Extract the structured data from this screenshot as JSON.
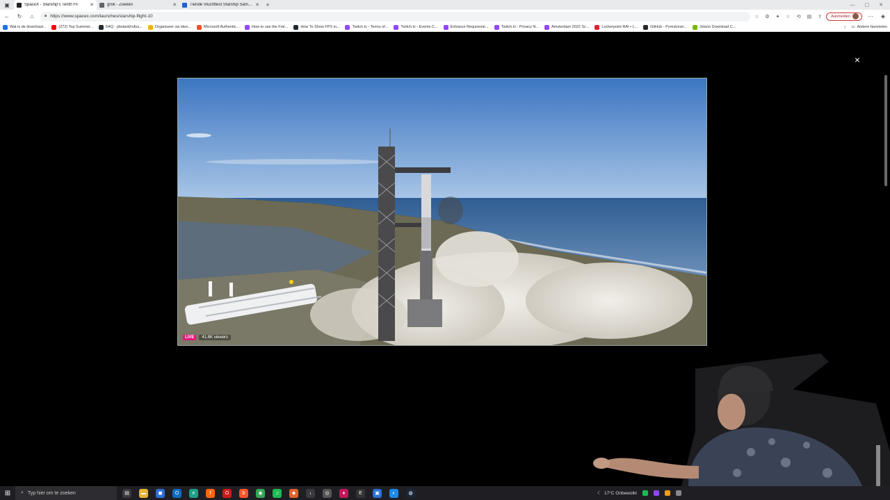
{
  "browser": {
    "tabs": [
      {
        "title": "SpaceX - Starship's Tenth Fli",
        "active": true,
        "favicon_color": "#222222"
      },
      {
        "title": "grok - Zoeken",
        "active": false,
        "favicon_color": "#5f6368"
      },
      {
        "title": "Tiende Vluchttest Starship Samen",
        "active": false,
        "favicon_color": "#1f5fd6"
      }
    ],
    "new_tab_glyph": "+",
    "url": "https://www.spacex.com/launches/starship-flight-10",
    "signin_label": "Aanmelden",
    "favorites": [
      {
        "label": "Wat is de download...",
        "color": "#1a73e8"
      },
      {
        "label": "(272) Top Summer...",
        "color": "#ff0000"
      },
      {
        "label": "FAQ · pbstard/rufus...",
        "color": "#24292f"
      },
      {
        "label": "Organiseer uw idee...",
        "color": "#f4b400"
      },
      {
        "label": "Microsoft Authentic...",
        "color": "#f25022"
      },
      {
        "label": "How to use the Frie...",
        "color": "#9146ff"
      },
      {
        "label": "How To Show FPS in...",
        "color": "#24292f"
      },
      {
        "label": "Twitch.tv - Terms of...",
        "color": "#9146ff"
      },
      {
        "label": "Twitch.tv - Events C...",
        "color": "#9146ff"
      },
      {
        "label": "Entrance Requireme...",
        "color": "#9146ff"
      },
      {
        "label": "Twitch.tv - Privacy N...",
        "color": "#9146ff"
      },
      {
        "label": "Amsterdam 2022 Sc...",
        "color": "#9146ff"
      },
      {
        "label": "Lockerpoint RAI • L...",
        "color": "#d23"
      },
      {
        "label": "GitHub - Pyrestone/...",
        "color": "#24292f"
      },
      {
        "label": "Jetson Download C...",
        "color": "#76b900"
      }
    ],
    "other_favorites": "Andere favorieten"
  },
  "page": {
    "close_glyph": "×",
    "video": {
      "live_label": "LIVE",
      "viewers": "41.8K viewers"
    }
  },
  "taskbar": {
    "search_placeholder": "Typ hier om te zoeken",
    "weather": "17°C  Onbewolkt",
    "apps": [
      {
        "name": "task-view",
        "color": "#3a3a3e",
        "glyph": "▤"
      },
      {
        "name": "file-explorer",
        "color": "#e8b23a",
        "glyph": "▬"
      },
      {
        "name": "store",
        "color": "#2b6fd6",
        "glyph": "◼"
      },
      {
        "name": "outlook",
        "color": "#0f6cbd",
        "glyph": "O"
      },
      {
        "name": "edge",
        "color": "#1f9e88",
        "glyph": "e"
      },
      {
        "name": "firefox",
        "color": "#ff6611",
        "glyph": "f"
      },
      {
        "name": "opera",
        "color": "#cc1a1a",
        "glyph": "O"
      },
      {
        "name": "brave",
        "color": "#fb542b",
        "glyph": "b"
      },
      {
        "name": "chrome",
        "color": "#34a853",
        "glyph": "◉"
      },
      {
        "name": "spotify",
        "color": "#1db954",
        "glyph": "♫"
      },
      {
        "name": "app-orange",
        "color": "#e2622e",
        "glyph": "◆"
      },
      {
        "name": "downloads",
        "color": "#3a3a3e",
        "glyph": "↓"
      },
      {
        "name": "obs",
        "color": "#555",
        "glyph": "◎"
      },
      {
        "name": "app-pink",
        "color": "#c2185b",
        "glyph": "♦"
      },
      {
        "name": "epic",
        "color": "#333",
        "glyph": "E"
      },
      {
        "name": "remote",
        "color": "#2a6fd6",
        "glyph": "▣"
      },
      {
        "name": "app-blue",
        "color": "#1e88e5",
        "glyph": "◐"
      },
      {
        "name": "steam",
        "color": "#1b2838",
        "glyph": "◍"
      }
    ]
  },
  "colors": {
    "sky_top": "#3c76c2",
    "sky_bottom": "#a9c6e6",
    "ocean": "#2f5d93",
    "ground": "#6c6a55",
    "smoke": "#e7e4dd",
    "live_tag": "#e6177a"
  }
}
